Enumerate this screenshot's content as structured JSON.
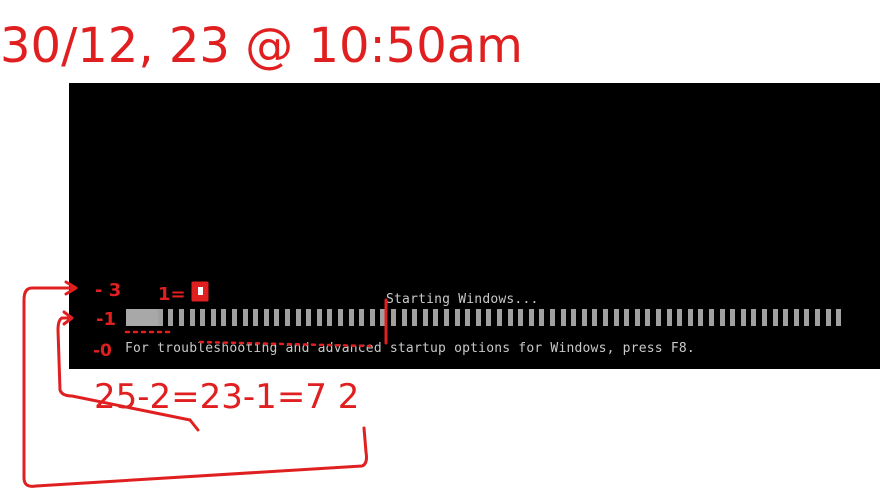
{
  "boot": {
    "status_text": "Starting Windows...",
    "hint_text": "For troubleshooting and advanced startup options for Windows, press F8."
  },
  "progress": {
    "segments_total": 68,
    "segments_lit": 3
  },
  "annotations": {
    "datetime": "30/12, 23 @ 10:50am",
    "mark_3": "- 3",
    "mark_1": "1=",
    "mark_neg1": "-1",
    "mark_0": "-0",
    "calc": "25-2=23-1=7 2"
  },
  "colors": {
    "screen": "#000000",
    "text": "#c9c9c9",
    "bar_lit": "#a8a8a8",
    "bar_unlit": "#a0a0a0",
    "annotation": "#e02020"
  }
}
